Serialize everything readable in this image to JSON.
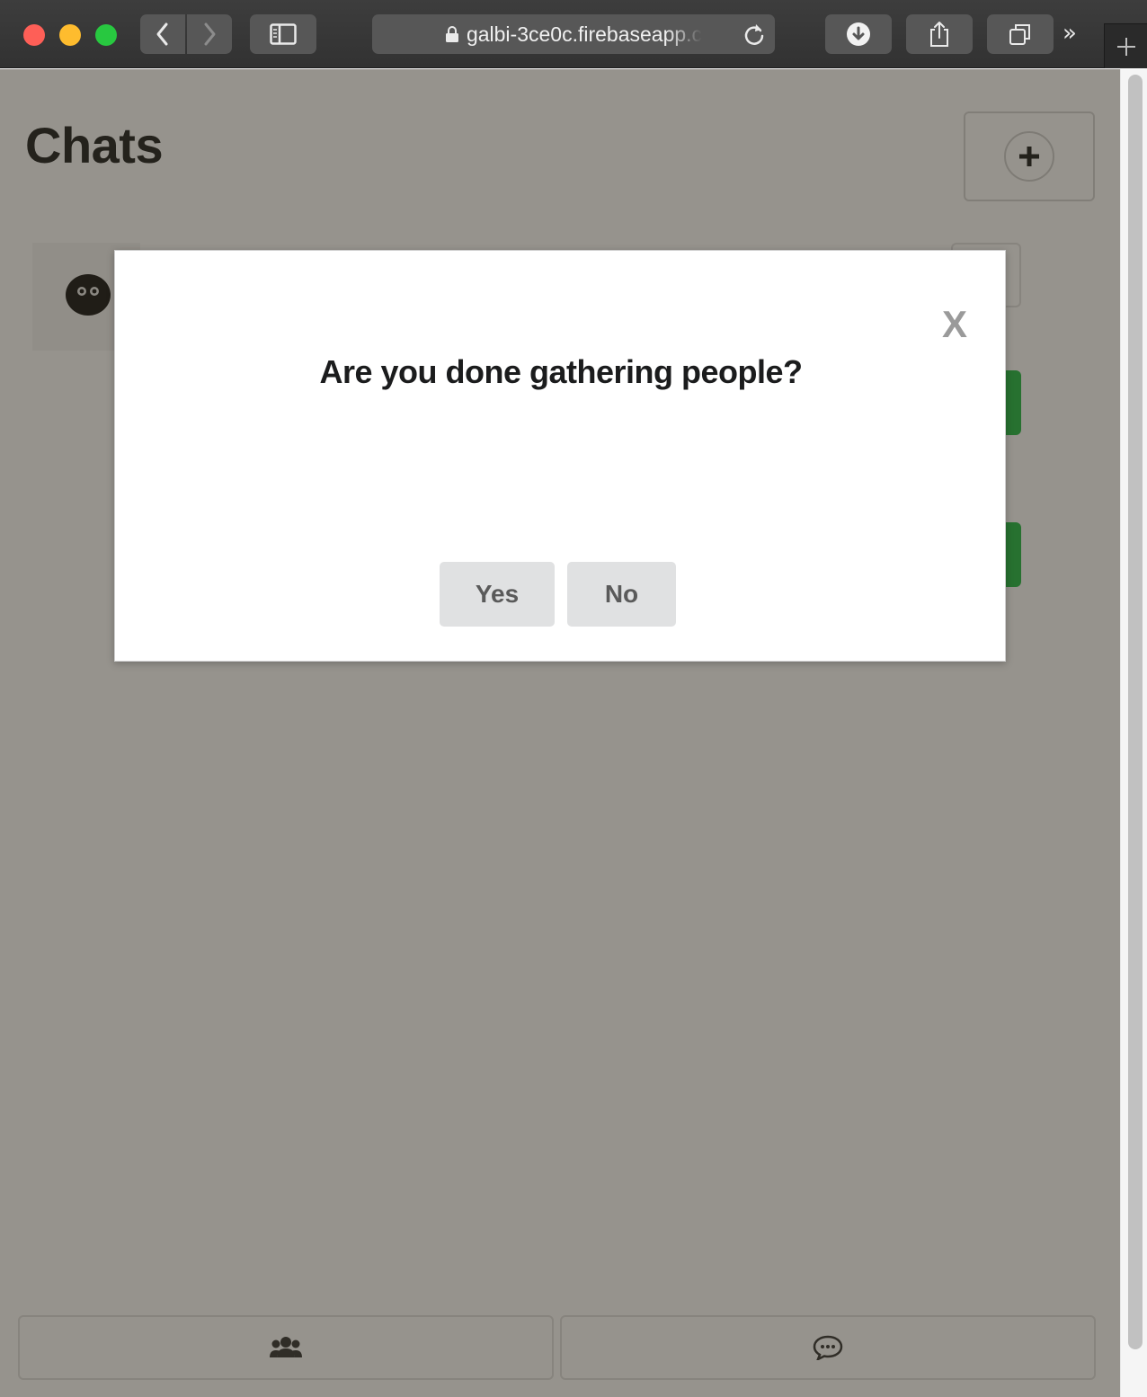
{
  "browser": {
    "url": "galbi-3ce0c.firebaseapp.c",
    "icons": {
      "back": "chevron-left-icon",
      "forward": "chevron-right-icon",
      "sidebar": "sidebar-icon",
      "lock": "lock-icon",
      "reload": "reload-icon",
      "download": "download-icon",
      "share": "share-icon",
      "tabs": "tab-overview-icon",
      "more": "double-chevron-right-icon",
      "new_tab": "plus-icon"
    },
    "more_label": "»"
  },
  "page": {
    "title": "Chats",
    "add_button_icon": "plus-circle-icon",
    "bottom_nav": {
      "people_icon": "users-icon",
      "chats_icon": "chat-bubble-icon"
    }
  },
  "modal": {
    "close_label": "X",
    "question": "Are you done gathering people?",
    "yes_label": "Yes",
    "no_label": "No"
  },
  "colors": {
    "accent_green": "#21ba45",
    "dimmer": "rgba(45, 40, 28, 0.5)",
    "button_gray": "#e0e1e2"
  }
}
